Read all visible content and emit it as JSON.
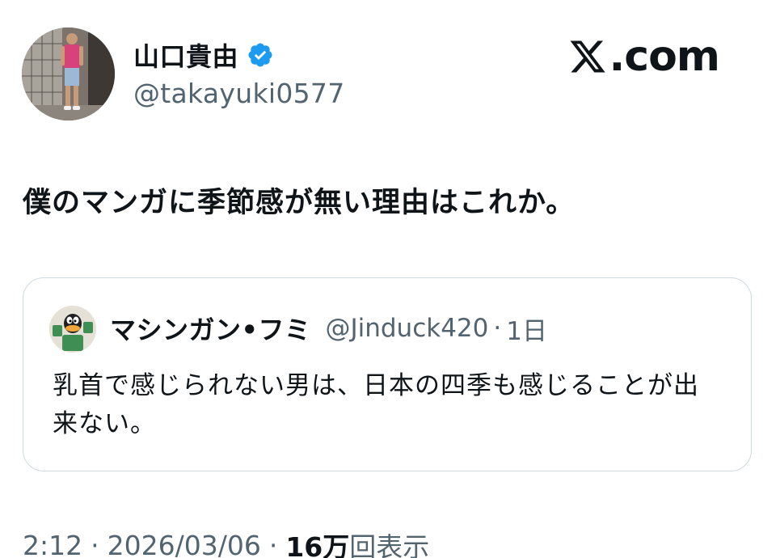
{
  "author": {
    "display_name": "山口貴由",
    "handle": "@takayuki0577",
    "verified": true,
    "avatar_icon": "profile-photo"
  },
  "brand": {
    "text": ".com",
    "logo_icon": "x-logo-icon"
  },
  "tweet": {
    "text": "僕のマンガに季節感が無い理由はこれか。"
  },
  "quote": {
    "display_name": "マシンガン•フミ",
    "handle": "@Jinduck420",
    "separator": "·",
    "time": "1日",
    "text": "乳首で感じられない男は、日本の四季も感じることが出来ない。",
    "avatar_icon": "cartoon-avatar-icon"
  },
  "meta": {
    "time": "2:12",
    "separator": "·",
    "date": "2026/03/06",
    "views_count": "16万",
    "views_label": "回表示"
  },
  "colors": {
    "text_primary": "#0f1419",
    "text_secondary": "#536471",
    "border": "#cfd9de",
    "verified_blue": "#1d9bf0"
  }
}
